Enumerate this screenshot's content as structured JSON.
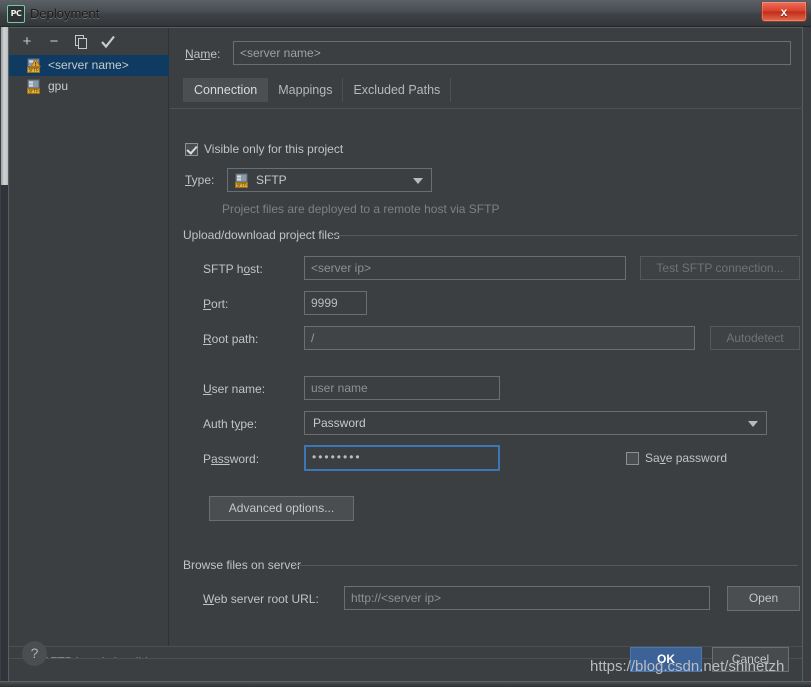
{
  "window": {
    "title": "Deployment",
    "app_icon": "PC",
    "close_label": "x"
  },
  "toolbar": {
    "add": "+",
    "remove": "−",
    "copy": "copy-icon",
    "check": "✓"
  },
  "servers": [
    {
      "name": "<server name>",
      "icon": "sftp-warning-icon",
      "selected": true
    },
    {
      "name": "gpu",
      "icon": "sftp-icon",
      "selected": false
    }
  ],
  "form": {
    "name_label": "Name:",
    "name_value": "<server name>",
    "tabs": [
      {
        "label": "Connection",
        "active": true
      },
      {
        "label": "Mappings",
        "active": false
      },
      {
        "label": "Excluded Paths",
        "active": false
      }
    ],
    "visible_only_label": "Visible only for this project",
    "visible_only_checked": true,
    "type_label": "Type:",
    "type_value": "SFTP",
    "type_hint": "Project files are deployed to a remote host via SFTP",
    "upload_group": "Upload/download project files",
    "sftp_host_label": "SFTP host:",
    "sftp_host_value": "<server ip>",
    "test_connection_label": "Test SFTP connection...",
    "port_label": "Port:",
    "port_value": "9999",
    "root_path_label": "Root path:",
    "root_path_value": "/",
    "autodetect_label": "Autodetect",
    "user_name_label": "User name:",
    "user_name_value": "user name",
    "auth_type_label": "Auth type:",
    "auth_type_value": "Password",
    "password_label": "Password:",
    "password_value": "••••••••",
    "save_password_label": "Save password",
    "save_password_checked": false,
    "advanced_options_label": "Advanced options...",
    "browse_group": "Browse files on server",
    "web_url_label": "Web server root URL:",
    "web_url_value": "http://<server ip>",
    "open_label": "Open"
  },
  "status": {
    "error_text": "SFTP host is invalid",
    "error_icon": "warning-triangle-icon"
  },
  "buttons": {
    "help": "?",
    "ok": "OK",
    "cancel": "Cancel"
  },
  "watermark": "https://blog.csdn.net/shinetzh",
  "colors": {
    "background": "#3c3f41",
    "selection": "#0f3b62",
    "accent": "#3d6298",
    "focus_border": "#3c77b5",
    "warning": "#e8a33d"
  }
}
